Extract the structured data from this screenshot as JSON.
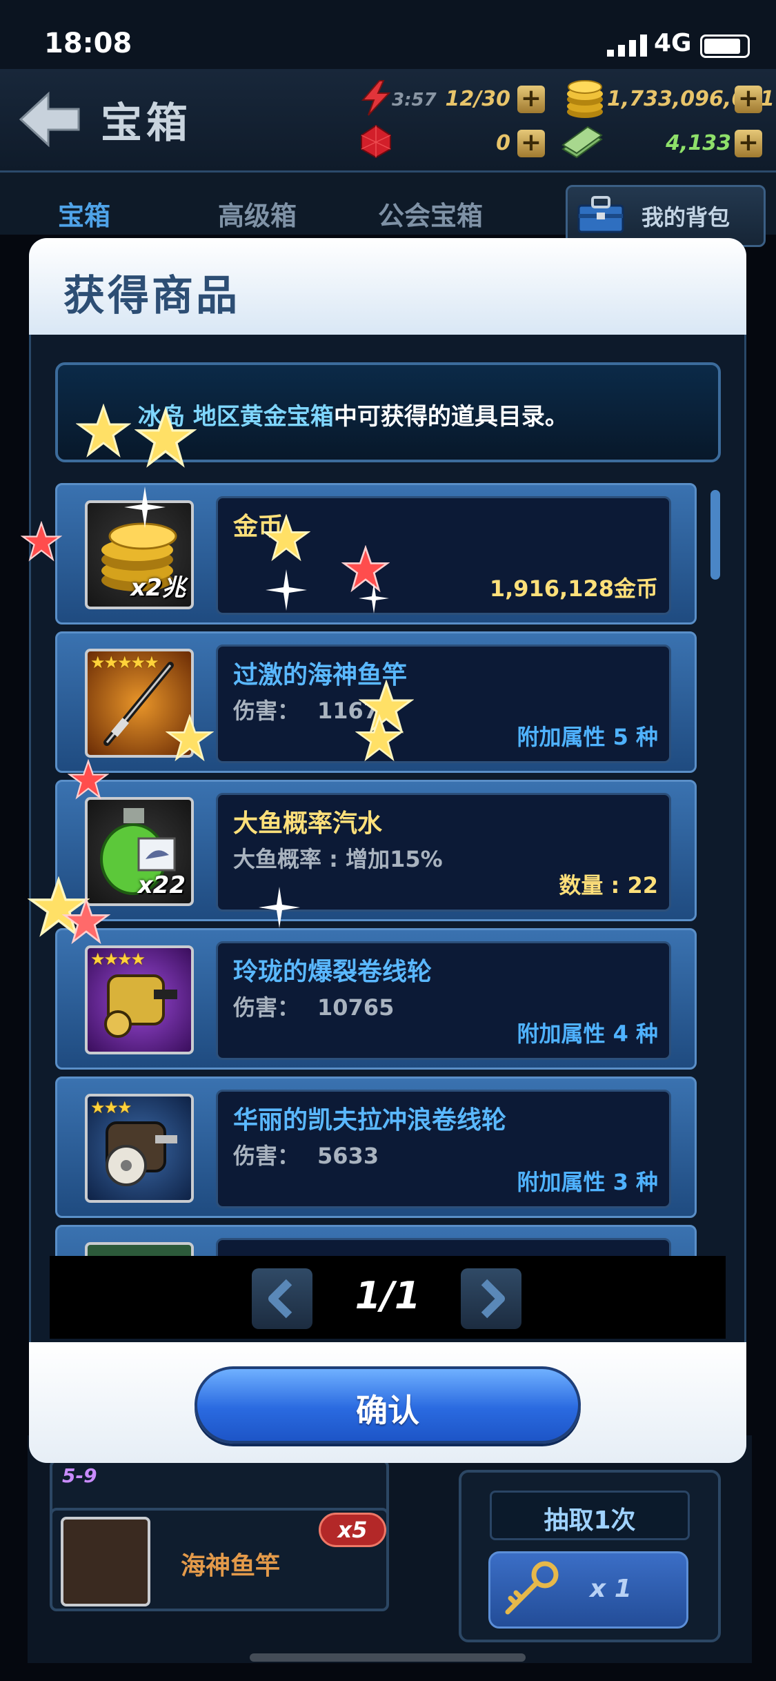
{
  "status_bar": {
    "time": "18:08",
    "network": "4G"
  },
  "header": {
    "title": "宝箱",
    "energy_timer": "3:57",
    "energy": "12/30",
    "coins": "1,733,096,631",
    "gems": "0",
    "cash": "4,133"
  },
  "tabs": [
    {
      "label": "宝箱",
      "color": "#4fa3e8"
    },
    {
      "label": "高级箱",
      "color": "#7f92a6"
    },
    {
      "label": "公会宝箱",
      "color": "#7f92a6"
    }
  ],
  "bag_button": {
    "label": "我的背包"
  },
  "modal": {
    "title": "获得商品",
    "description": {
      "region": "冰岛 地区黄金宝箱",
      "rest": "中可获得的道具目录。"
    },
    "items": [
      {
        "name": "金币",
        "name_color": "#ffe07a",
        "stars": "",
        "badge": "x2兆",
        "sub_label": "",
        "sub_value": "",
        "right": "1,916,128金币",
        "right_color": "#ffe07a"
      },
      {
        "name": "过激的海神鱼竿",
        "name_color": "#5ab8ff",
        "stars": "★★★★★",
        "badge": "",
        "sub_label": "伤害：",
        "sub_value": "11675",
        "right": "附加属性 5 种",
        "right_color": "#4fb2ff"
      },
      {
        "name": "大鱼概率汽水",
        "name_color": "#ffe07a",
        "stars": "",
        "badge": "x22",
        "sub_label": "大鱼概率 : 增加15%",
        "sub_value": "",
        "right": "数量 : 22",
        "right_color": "#ffe07a"
      },
      {
        "name": "玲珑的爆裂卷线轮",
        "name_color": "#5ab8ff",
        "stars": "★★★★",
        "badge": "",
        "sub_label": "伤害：",
        "sub_value": "10765",
        "right": "附加属性 4 种",
        "right_color": "#4fb2ff"
      },
      {
        "name": "华丽的凯夫拉冲浪卷线轮",
        "name_color": "#5ab8ff",
        "stars": "★★★",
        "badge": "",
        "sub_label": "伤害：",
        "sub_value": "5633",
        "right": "附加属性 3 种",
        "right_color": "#4fb2ff"
      }
    ],
    "page": "1/1",
    "confirm": "确认"
  },
  "lower": {
    "tier": "5-9",
    "rod_label": "海神鱼竿",
    "rod_badge": "x5",
    "draw_label": "抽取1次",
    "key_count": "x 1"
  }
}
